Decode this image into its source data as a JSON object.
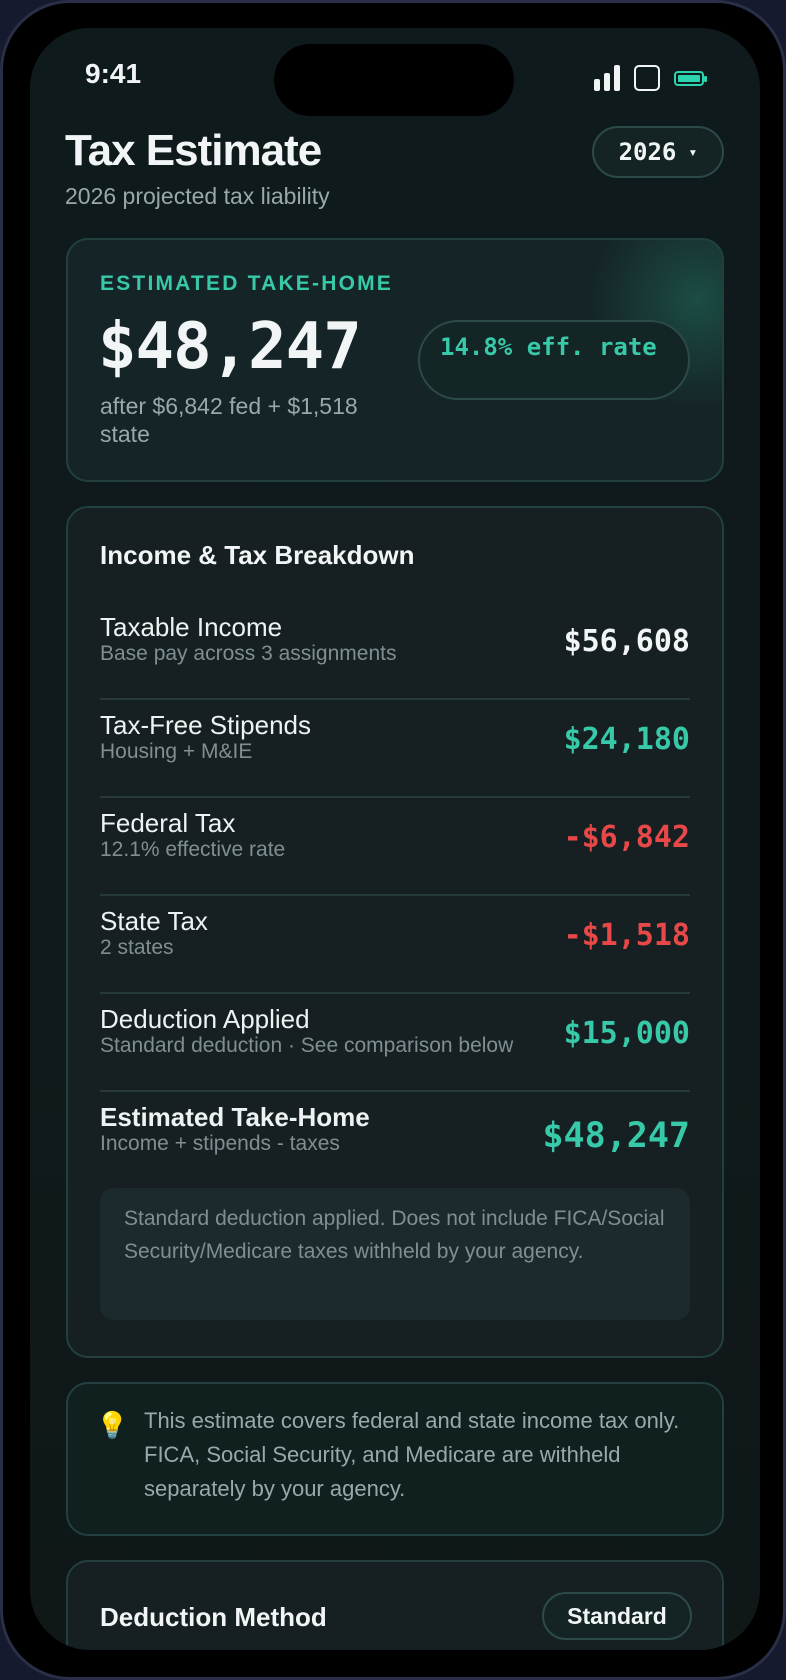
{
  "status_bar": {
    "time": "9:41"
  },
  "header": {
    "title": "Tax Estimate",
    "subtitle": "2026 projected tax liability",
    "year": "2026",
    "year_caret": "▾"
  },
  "hero": {
    "label": "ESTIMATED TAKE-HOME",
    "value": "$48,247",
    "note": "after $6,842 fed + $1,518 state",
    "rate": "14.8% eff. rate"
  },
  "breakdown": {
    "title": "Income & Tax Breakdown",
    "rows": [
      {
        "label": "Taxable Income",
        "sub": "Base pay across 3 assignments",
        "value": "$56,608"
      },
      {
        "label": "Tax-Free Stipends",
        "sub": "Housing + M&IE",
        "value": "$24,180"
      },
      {
        "label": "Federal Tax",
        "sub": "12.1% effective rate",
        "value": "-$6,842"
      },
      {
        "label": "State Tax",
        "sub": "2 states",
        "value": "-$1,518"
      },
      {
        "label": "Deduction Applied",
        "sub": "Standard deduction · See comparison below",
        "value": "$15,000"
      },
      {
        "label": "Estimated Take-Home",
        "sub": "Income + stipends - taxes",
        "value": "$48,247"
      }
    ],
    "disclaimer": "Standard deduction applied. Does not include FICA/Social Security/Medicare taxes withheld by your agency."
  },
  "info": {
    "icon": "lightbulb-icon",
    "text": "This estimate covers federal and state income tax only. FICA, Social Security, and Medicare are withheld separately by your agency."
  },
  "deduction": {
    "title": "Deduction Method",
    "method": "Standard"
  },
  "colors": {
    "accent": "#38c9a8",
    "negative": "#e84848",
    "background": "#0f1a1c"
  }
}
